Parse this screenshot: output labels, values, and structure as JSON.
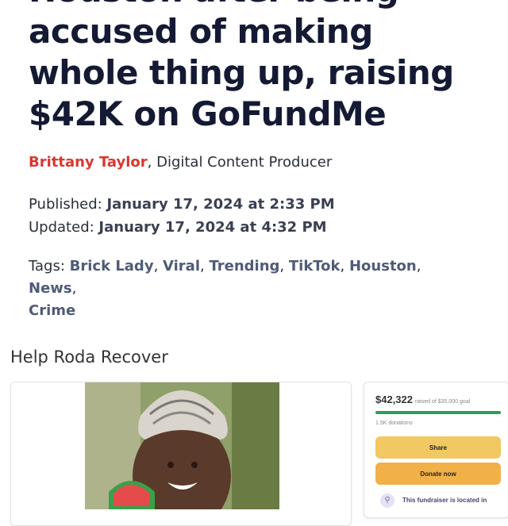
{
  "article": {
    "headline_lines": [
      "Houston after being",
      "accused of making",
      "whole thing up, raising",
      "$42K on GoFundMe"
    ],
    "author": "Brittany Taylor",
    "author_role": ", Digital Content Producer",
    "published_label": "Published: ",
    "published_date": "January 17, 2024 at 2:33 PM",
    "updated_label": "Updated: ",
    "updated_date": "January 17, 2024 at 4:32 PM",
    "tags_label": "Tags: ",
    "tags": [
      "Brick Lady",
      "Viral",
      "Trending",
      "TikTok",
      "Houston",
      "News",
      "Crime"
    ]
  },
  "gofundme": {
    "title": "Help Roda Recover",
    "raised": "$42,322",
    "goal_text": "raised of $35,000 goal",
    "progress": 1.0,
    "donations": "1.5K donations",
    "share_label": "Share",
    "donate_label": "Donate now",
    "location_text": "This fundraiser is located in"
  },
  "colors": {
    "headline": "#141a33",
    "author": "#d8372f",
    "tag": "#4f5b78",
    "progress": "#2a9d5a",
    "share_button": "#f1c861",
    "donate_button": "#f2b048"
  }
}
